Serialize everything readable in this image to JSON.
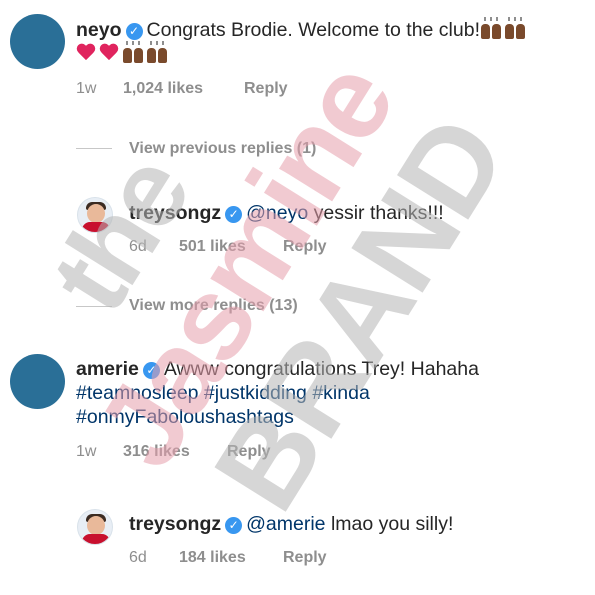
{
  "comments": [
    {
      "username": "neyo",
      "verified": true,
      "text": "Congrats Brodie. Welcome to the club!",
      "time": "1w",
      "likes": "1,024 likes",
      "reply": "Reply"
    },
    {
      "username": "treysongz",
      "verified": true,
      "mention": "@neyo",
      "text": "yessir thanks!!!",
      "time": "6d",
      "likes": "501 likes",
      "reply": "Reply"
    },
    {
      "username": "amerie",
      "verified": true,
      "text": "Awww congratulations Trey! Hahaha",
      "hashtags_line2": "#teamnosleep #justkidding #kinda",
      "hashtags_line3": "#onmyFaboloushashtags",
      "time": "1w",
      "likes": "316 likes",
      "reply": "Reply"
    },
    {
      "username": "treysongz",
      "verified": true,
      "mention": "@amerie",
      "text": "lmao you silly!",
      "time": "6d",
      "likes": "184 likes",
      "reply": "Reply"
    }
  ],
  "view_previous": "View previous replies (1)",
  "view_more": "View more replies (13)",
  "verified_mark": "✓",
  "watermark": {
    "line1": "the",
    "line2": "Jasmine",
    "line3": "BRAND"
  },
  "colors": {
    "link": "#003569",
    "muted": "#8e8e8e",
    "verified": "#3897f0",
    "watermark_pink": "#e7a0ad",
    "watermark_gray": "#b5b5b5"
  }
}
